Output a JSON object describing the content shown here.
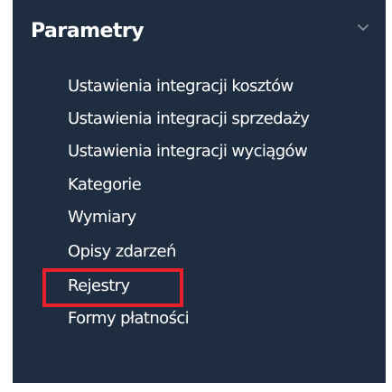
{
  "sidebar": {
    "section_title": "Parametry",
    "chevron_icon": "chevron-down-icon",
    "background_color": "#1f2d40",
    "text_color": "#ffffff",
    "items": [
      {
        "label": "Ustawienia integracji kosztów"
      },
      {
        "label": "Ustawienia integracji sprzedaży"
      },
      {
        "label": "Ustawienia integracji wyciągów"
      },
      {
        "label": "Kategorie"
      },
      {
        "label": "Wymiary"
      },
      {
        "label": "Opisy zdarzeń"
      },
      {
        "label": "Rejestry",
        "highlighted": true
      },
      {
        "label": "Formy płatności"
      }
    ]
  },
  "annotation": {
    "highlight_color": "#e8202a",
    "highlighted_item": "Rejestry"
  }
}
